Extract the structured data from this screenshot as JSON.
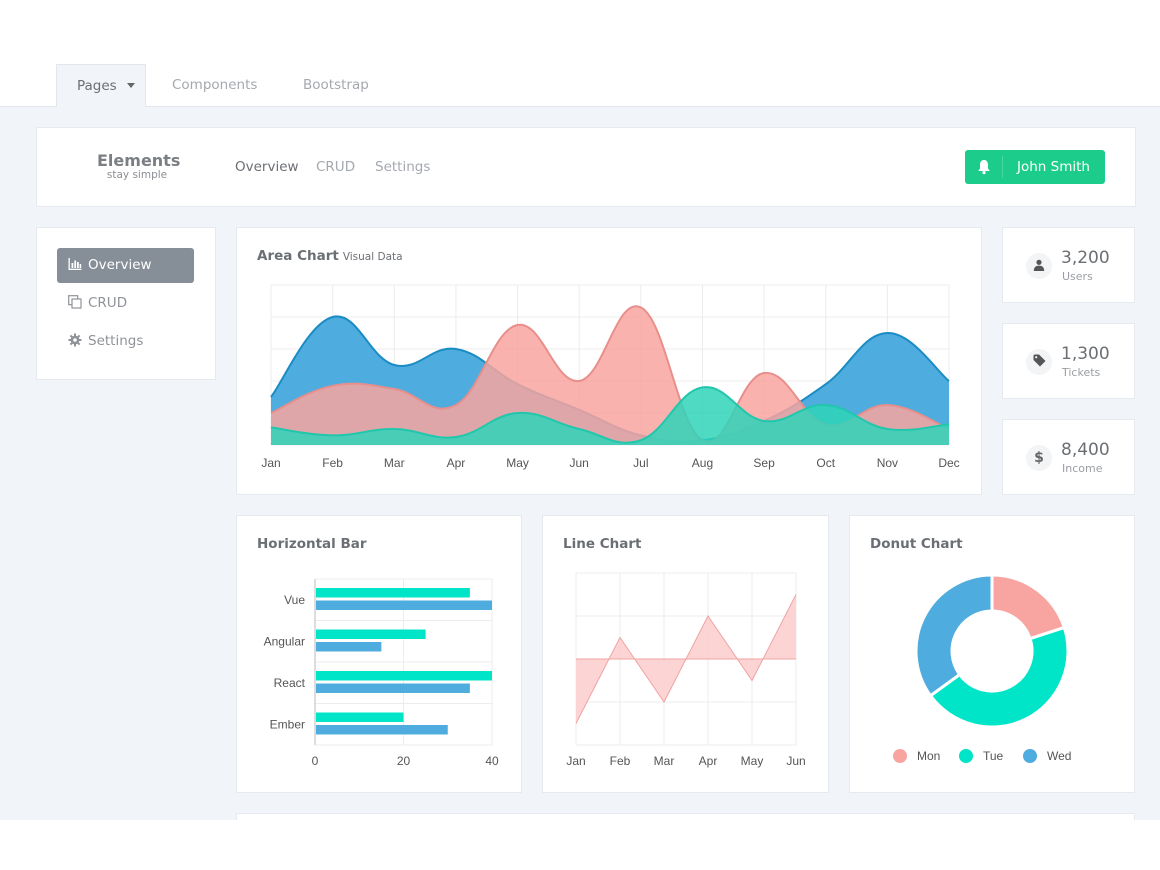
{
  "topnav": {
    "tabs": [
      {
        "label": "Pages",
        "active": true,
        "dropdown": true
      },
      {
        "label": "Components",
        "active": false
      },
      {
        "label": "Bootstrap",
        "active": false
      }
    ]
  },
  "header": {
    "brand_title": "Elements",
    "brand_subtitle": "stay simple",
    "nav": [
      {
        "label": "Overview",
        "active": true
      },
      {
        "label": "CRUD",
        "active": false
      },
      {
        "label": "Settings",
        "active": false
      }
    ],
    "user_button": {
      "label": "John Smith",
      "icon": "bell-icon",
      "color": "#1ccc8a"
    }
  },
  "sidebar": {
    "items": [
      {
        "label": "Overview",
        "icon": "bar-chart-icon",
        "active": true
      },
      {
        "label": "CRUD",
        "icon": "copy-icon",
        "active": false
      },
      {
        "label": "Settings",
        "icon": "gear-icon",
        "active": false
      }
    ]
  },
  "stats": [
    {
      "value": "3,200",
      "label": "Users",
      "icon": "user-icon"
    },
    {
      "value": "1,300",
      "label": "Tickets",
      "icon": "tag-icon"
    },
    {
      "value": "8,400",
      "label": "Income",
      "icon": "dollar-icon",
      "glyph": "$"
    }
  ],
  "colors": {
    "blue": "#4facde",
    "pink": "#f8a4a0",
    "teal": "#00e5c8",
    "teal_area": "#2fd3b8",
    "line_fill": "#fdcfcf",
    "line_stroke": "#f0a3a3",
    "grid": "#ececec",
    "label": "#555555"
  },
  "chart_data": [
    {
      "type": "area",
      "title": "Area Chart",
      "subtitle": "Visual Data",
      "categories": [
        "Jan",
        "Feb",
        "Mar",
        "Apr",
        "May",
        "Jun",
        "Jul",
        "Aug",
        "Sep",
        "Oct",
        "Nov",
        "Dec"
      ],
      "ylim": [
        0,
        100
      ],
      "y_ticks_shown": false,
      "grid": true,
      "series": [
        {
          "name": "blue",
          "color": "#4facde",
          "values": [
            30,
            80,
            50,
            60,
            38,
            22,
            6,
            3,
            15,
            38,
            70,
            40
          ]
        },
        {
          "name": "pink",
          "color": "#f8a4a0",
          "values": [
            20,
            37,
            35,
            25,
            75,
            40,
            86,
            3,
            45,
            13,
            25,
            10
          ]
        },
        {
          "name": "teal",
          "color": "#2fd3b8",
          "values": [
            11,
            6,
            10,
            5,
            20,
            10,
            3,
            36,
            15,
            25,
            10,
            13
          ]
        }
      ]
    },
    {
      "type": "bar",
      "orientation": "horizontal",
      "title": "Horizontal Bar",
      "categories": [
        "Vue",
        "Angular",
        "React",
        "Ember"
      ],
      "xlim": [
        0,
        40
      ],
      "x_ticks": [
        0,
        20,
        40
      ],
      "grid": true,
      "series": [
        {
          "name": "series-1",
          "color": "#00e5c8",
          "values": [
            35,
            25,
            40,
            20
          ]
        },
        {
          "name": "series-2",
          "color": "#4facde",
          "values": [
            40,
            15,
            35,
            30
          ]
        }
      ]
    },
    {
      "type": "line",
      "title": "Line Chart",
      "categories": [
        "Jan",
        "Feb",
        "Mar",
        "Apr",
        "May",
        "Jun"
      ],
      "ylim": [
        -20,
        20
      ],
      "y_ticks_shown": false,
      "grid": true,
      "fill": "to-zero",
      "values": [
        -15,
        5,
        -10,
        10,
        -5,
        15
      ]
    },
    {
      "type": "pie",
      "variant": "donut",
      "title": "Donut Chart",
      "labels": [
        "Mon",
        "Tue",
        "Wed"
      ],
      "values": [
        20,
        45,
        35
      ],
      "colors": [
        "#f8a4a0",
        "#00e5c8",
        "#4facde"
      ],
      "legend": "bottom"
    }
  ]
}
